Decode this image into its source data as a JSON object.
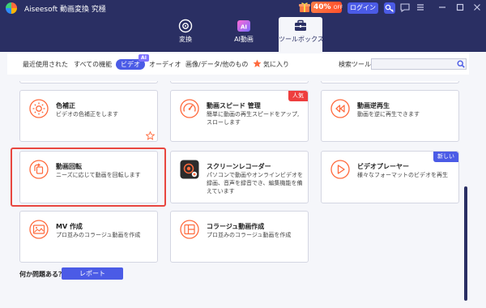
{
  "app": {
    "title": "Aiseesoft 動画変換 究極"
  },
  "topbar": {
    "promo": {
      "percent": "40%",
      "suffix": "OFF"
    },
    "login_label": "ログイン"
  },
  "tabs": [
    {
      "label": "変換",
      "icon": "convert-icon"
    },
    {
      "label": "AI動画",
      "icon": "ai-video-icon",
      "badge": "AI"
    },
    {
      "label": "ツールボックス",
      "icon": "toolbox-icon",
      "active": true
    }
  ],
  "filters": {
    "items": [
      "最近使用された",
      "すべての機能",
      "ビデオ",
      "オーディオ",
      "画像/データ/他のもの",
      "気に入り"
    ],
    "active": "ビデオ",
    "ai_badge": "AI",
    "search_label": "検索ツール:",
    "search_value": ""
  },
  "tools": [
    {
      "title": "色補正",
      "desc": "ビデオの色補正をします",
      "icon": "color-correction-icon",
      "favorite": true
    },
    {
      "title": "動画スピード 管理",
      "desc": "簡単に動画の再生スピードをアップ, スローします",
      "icon": "speed-gauge-icon",
      "badge": "人気"
    },
    {
      "title": "動画逆再生",
      "desc": "動画を逆に再生できます",
      "icon": "rewind-icon"
    },
    {
      "title": "動画回転",
      "desc": "ニーズに応じて動画を回転します",
      "icon": "rotate-icon",
      "selected": true
    },
    {
      "title": "スクリーンレコーダー",
      "desc": "パソコンで動画やオンラインビデオを録画、音声を録音でき、編集機能を備えています",
      "icon": "screen-recorder-icon"
    },
    {
      "title": "ビデオプレーヤー",
      "desc": "様々なフォーマットのビデオを再生",
      "icon": "play-icon",
      "badge": "新しい"
    },
    {
      "title": "MV 作成",
      "desc": "プロ並みのコラージュ動画を作成",
      "icon": "mv-maker-icon"
    },
    {
      "title": "コラージュ動画作成",
      "desc": "プロ並みのコラージュ動画を作成",
      "icon": "collage-icon"
    }
  ],
  "footer": {
    "question": "何か問題ある？",
    "report_label": "レポート"
  },
  "colors": {
    "header": "#2a2f63",
    "accent": "#4b5be6",
    "icon_orange": "#ff6a3d",
    "badge_red": "#ee3e3e",
    "selection": "#e8463f"
  }
}
